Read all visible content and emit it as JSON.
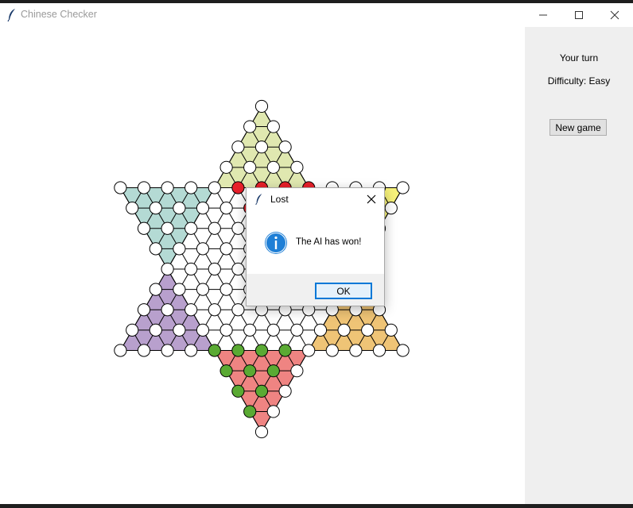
{
  "window": {
    "title": "Chinese Checker"
  },
  "side_panel": {
    "turn_text": "Your turn",
    "difficulty_text": "Difficulty: Easy",
    "new_game_label": "New game"
  },
  "dialog": {
    "title": "Lost",
    "message": "The AI has won!",
    "ok_label": "OK"
  },
  "board": {
    "colors": {
      "top": "#e0e8b0",
      "top_right": "#f7f27a",
      "bottom_right": "#efc476",
      "bottom": "#ef8482",
      "bottom_left": "#b8a0cd",
      "top_left": "#b4dad4",
      "center": "#ffffff",
      "red_marble": "#e8202a",
      "green_marble": "#5aaa33",
      "empty_hole": "#ffffff"
    },
    "red_marbles": [
      [
        -3,
        4
      ],
      [
        -2,
        4
      ],
      [
        -2,
        3
      ],
      [
        -1,
        4
      ],
      [
        -1,
        3
      ],
      [
        -1,
        2
      ],
      [
        0,
        4
      ],
      [
        0,
        3
      ],
      [
        2,
        -1
      ],
      [
        2,
        0
      ]
    ],
    "green_marbles": [
      [
        0,
        -4
      ],
      [
        1,
        -4
      ],
      [
        2,
        -4
      ],
      [
        3,
        -4
      ],
      [
        1,
        -5
      ],
      [
        2,
        -5
      ],
      [
        3,
        -5
      ],
      [
        2,
        -6
      ],
      [
        3,
        -6
      ],
      [
        3,
        -7
      ]
    ]
  }
}
